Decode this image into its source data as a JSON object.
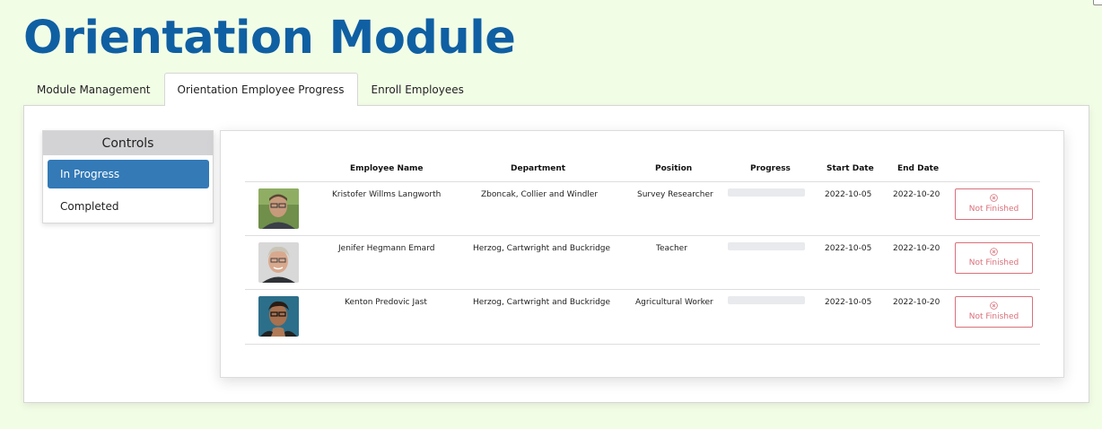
{
  "page": {
    "title": "Orientation Module"
  },
  "tabs": [
    {
      "label": "Module Management",
      "active": false
    },
    {
      "label": "Orientation Employee Progress",
      "active": true
    },
    {
      "label": "Enroll Employees",
      "active": false
    }
  ],
  "controls": {
    "title": "Controls",
    "items": [
      {
        "label": "In Progress",
        "active": true
      },
      {
        "label": "Completed",
        "active": false
      }
    ]
  },
  "table": {
    "columns": [
      "Employee Name",
      "Department",
      "Position",
      "Progress",
      "Start Date",
      "End Date"
    ],
    "rows": [
      {
        "name": "Kristofer Willms Langworth",
        "department": "Zboncak, Collier and Windler",
        "position": "Survey Researcher",
        "progress": 0,
        "start_date": "2022-10-05",
        "end_date": "2022-10-20",
        "status": "Not Finished"
      },
      {
        "name": "Jenifer Hegmann Emard",
        "department": "Herzog, Cartwright and Buckridge",
        "position": "Teacher",
        "progress": 0,
        "start_date": "2022-10-05",
        "end_date": "2022-10-20",
        "status": "Not Finished"
      },
      {
        "name": "Kenton Predovic Jast",
        "department": "Herzog, Cartwright and Buckridge",
        "position": "Agricultural Worker",
        "progress": 0,
        "start_date": "2022-10-05",
        "end_date": "2022-10-20",
        "status": "Not Finished"
      }
    ]
  },
  "colors": {
    "background": "#f2fde6",
    "title": "#0f5fa3",
    "accent": "#337ab7",
    "status_not_finished": "#d9707a"
  },
  "icons": {
    "status": "circle-x-icon"
  }
}
